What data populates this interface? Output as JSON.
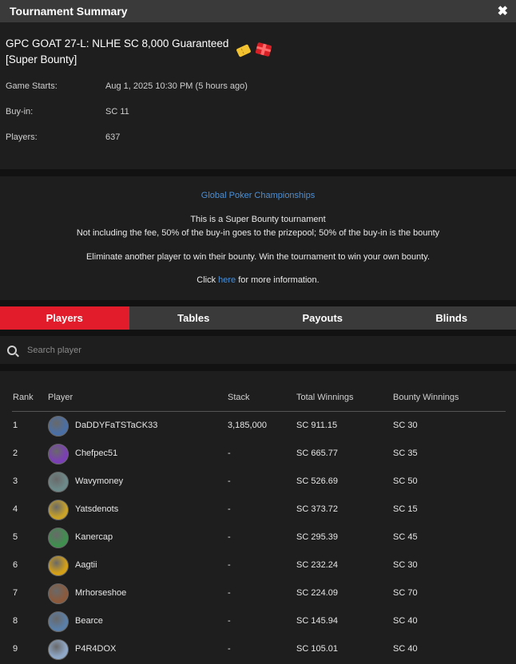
{
  "header": {
    "title": "Tournament Summary",
    "close_glyph": "✖"
  },
  "tournament": {
    "name": "GPC GOAT 27-L: NLHE SC 8,000 Guaranteed [Super Bounty]",
    "badges": [
      "ticket-icon",
      "gift-icon"
    ],
    "details": [
      {
        "label": "Game Starts:",
        "value": "Aug 1, 2025 10:30 PM (5 hours ago)"
      },
      {
        "label": "Buy-in:",
        "value": "SC 11"
      },
      {
        "label": "Players:",
        "value": "637"
      }
    ]
  },
  "description": {
    "series_link": "Global Poker Championships",
    "line1": "This is a Super Bounty tournament",
    "line2": "Not including the fee, 50% of the buy-in goes to the prizepool; 50% of the buy-in is the bounty",
    "line3": "Eliminate another player to win their bounty. Win the tournament to win your own bounty.",
    "click_prefix": "Click ",
    "click_link": "here",
    "click_suffix": " for more information."
  },
  "tabs": [
    {
      "label": "Players",
      "active": true
    },
    {
      "label": "Tables",
      "active": false
    },
    {
      "label": "Payouts",
      "active": false
    },
    {
      "label": "Blinds",
      "active": false
    }
  ],
  "search": {
    "placeholder": "Search player",
    "value": ""
  },
  "table": {
    "headers": {
      "rank": "Rank",
      "player": "Player",
      "stack": "Stack",
      "total": "Total Winnings",
      "bounty": "Bounty Winnings"
    },
    "rows": [
      {
        "rank": "1",
        "player": "DaDDYFaTSTaCK33",
        "stack": "3,185,000",
        "total": "SC 911.15",
        "bounty": "SC 30",
        "avatar_color": "#4a6fa5"
      },
      {
        "rank": "2",
        "player": "Chefpec51",
        "stack": "-",
        "total": "SC 665.77",
        "bounty": "SC 35",
        "avatar_color": "#7b3fb5"
      },
      {
        "rank": "3",
        "player": "Wavymoney",
        "stack": "-",
        "total": "SC 526.69",
        "bounty": "SC 50",
        "avatar_color": "#6d8a8a"
      },
      {
        "rank": "4",
        "player": "Yatsdenots",
        "stack": "-",
        "total": "SC 373.72",
        "bounty": "SC 15",
        "avatar_color": "#c9a227"
      },
      {
        "rank": "5",
        "player": "Kanercap",
        "stack": "-",
        "total": "SC 295.39",
        "bounty": "SC 45",
        "avatar_color": "#3f8f4f"
      },
      {
        "rank": "6",
        "player": "Aagtii",
        "stack": "-",
        "total": "SC 232.24",
        "bounty": "SC 30",
        "avatar_color": "#d4a017"
      },
      {
        "rank": "7",
        "player": "Mrhorseshoe",
        "stack": "-",
        "total": "SC 224.09",
        "bounty": "SC 70",
        "avatar_color": "#8b5a3c"
      },
      {
        "rank": "8",
        "player": "Bearce",
        "stack": "-",
        "total": "SC 145.94",
        "bounty": "SC 40",
        "avatar_color": "#5a7fa8"
      },
      {
        "rank": "9",
        "player": "P4R4DOX",
        "stack": "-",
        "total": "SC 105.01",
        "bounty": "SC 40",
        "avatar_color": "#8fa8c8"
      }
    ]
  }
}
